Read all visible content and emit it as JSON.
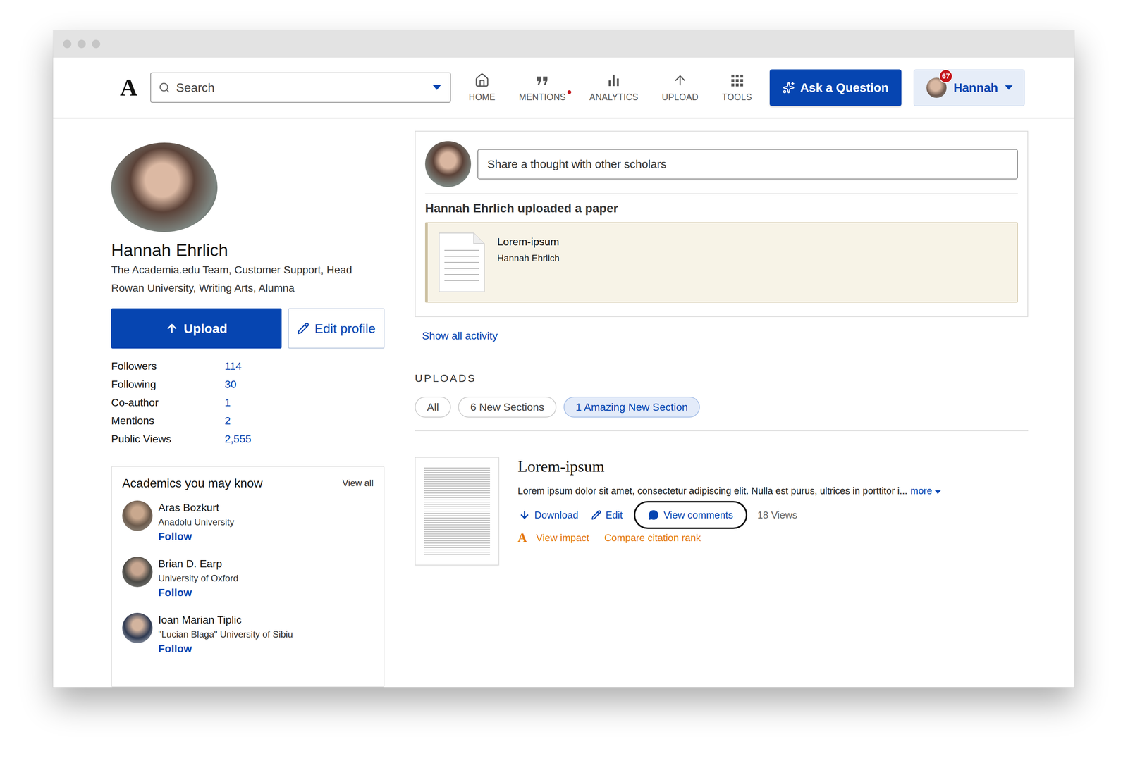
{
  "nav": {
    "logo": "A",
    "search": {
      "placeholder": "Search"
    },
    "items": [
      {
        "label": "HOME",
        "notification": false
      },
      {
        "label": "MENTIONS",
        "notification": true
      },
      {
        "label": "ANALYTICS",
        "notification": false
      },
      {
        "label": "UPLOAD",
        "notification": false
      },
      {
        "label": "TOOLS",
        "notification": false
      }
    ],
    "ask_button": "Ask a Question",
    "user": {
      "name": "Hannah",
      "badge": "67"
    }
  },
  "profile": {
    "name": "Hannah Ehrlich",
    "affiliations": [
      "The Academia.edu Team, Customer Support, Head",
      "Rowan University, Writing Arts, Alumna"
    ],
    "upload_button": "Upload",
    "edit_button": "Edit profile",
    "stats": [
      {
        "label": "Followers",
        "value": "114"
      },
      {
        "label": "Following",
        "value": "30"
      },
      {
        "label": "Co-author",
        "value": "1"
      },
      {
        "label": "Mentions",
        "value": "2"
      },
      {
        "label": "Public Views",
        "value": "2,555"
      }
    ]
  },
  "suggestions": {
    "title": "Academics you may know",
    "view_all": "View all",
    "people": [
      {
        "name": "Aras Bozkurt",
        "affiliation": "Anadolu University",
        "action": "Follow"
      },
      {
        "name": "Brian D. Earp",
        "affiliation": "University of Oxford",
        "action": "Follow"
      },
      {
        "name": "Ioan Marian Tiplic",
        "affiliation": "\"Lucian Blaga\" University of Sibiu",
        "action": "Follow"
      }
    ]
  },
  "activity": {
    "placeholder": "Share a thought with other scholars",
    "heading": "Hannah Ehrlich uploaded a paper",
    "paper": {
      "title": "Lorem-ipsum",
      "author": "Hannah Ehrlich"
    },
    "show_all": "Show all activity"
  },
  "uploads": {
    "heading": "UPLOADS",
    "tabs": [
      {
        "label": "All",
        "selected": false
      },
      {
        "label": "6 New Sections",
        "selected": false
      },
      {
        "label": "1 Amazing New Section",
        "selected": true
      }
    ],
    "items": [
      {
        "title": "Lorem-ipsum",
        "excerpt": "Lorem ipsum dolor sit amet, consectetur adipiscing elit. Nulla est purus, ultrices in porttitor i...",
        "more": "more",
        "actions": [
          {
            "label": "Download",
            "highlighted": false
          },
          {
            "label": "Edit",
            "highlighted": false
          },
          {
            "label": "View comments",
            "highlighted": true
          }
        ],
        "views": "18 Views",
        "impact": {
          "icon": "A",
          "links": [
            "View impact",
            "Compare citation rank"
          ]
        }
      }
    ]
  }
}
